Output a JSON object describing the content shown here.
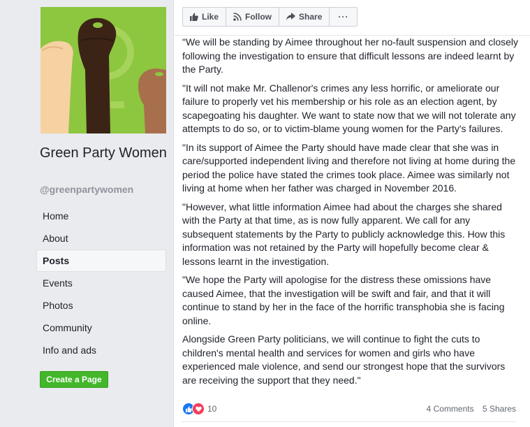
{
  "page": {
    "name": "Green Party Women",
    "handle": "@greenpartywomen"
  },
  "cover_image": {
    "description_icon": "raised-fists-image",
    "background_color": "#8dc63f"
  },
  "nav": {
    "items": [
      {
        "label": "Home",
        "active": false
      },
      {
        "label": "About",
        "active": false
      },
      {
        "label": "Posts",
        "active": true
      },
      {
        "label": "Events",
        "active": false
      },
      {
        "label": "Photos",
        "active": false
      },
      {
        "label": "Community",
        "active": false
      },
      {
        "label": "Info and ads",
        "active": false
      }
    ]
  },
  "create_page_label": "Create a Page",
  "actions": {
    "like": "Like",
    "follow": "Follow",
    "share": "Share",
    "more": "···"
  },
  "post": {
    "paragraphs": [
      "\"We will be standing by Aimee throughout her no-fault suspension and closely following the investigation to ensure that difficult lessons are indeed learnt by the Party.",
      "\"It will not make Mr. Challenor's crimes any less horrific, or ameliorate our failure to properly vet his membership or his role as an election agent, by scapegoating his daughter. We want to state now that we will not tolerate any attempts to do so, or to victim-blame young women for the Party's failures.",
      "\"In its support of Aimee the Party should have made clear that she was in care/supported independent living and therefore not living at home during the period the police have stated the crimes took place. Aimee was similarly not living at home when her father was charged in November 2016.",
      "\"However, what little information Aimee had about the charges she shared with the Party at that time, as is now fully apparent. We call for any subsequent statements by the Party to publicly acknowledge this. How this information was not retained by the Party will hopefully become clear & lessons learnt in the investigation.",
      "\"We hope the Party will apologise for the distress these omissions have caused Aimee, that the investigation will be swift and fair, and that it will continue to stand by her in the face of the horrific transphobia she is facing online.",
      "Alongside Green Party politicians, we will continue to fight the cuts to children's mental health and services for women and girls who have experienced male violence, and send our strongest hope that the survivors are receiving the support that they need.\""
    ],
    "reaction_count": "10",
    "comments": "4 Comments",
    "shares": "5 Shares"
  },
  "colors": {
    "page_bg": "#e9ebee",
    "create_button": "#42b72a",
    "like_reaction": "#1877f2",
    "love_reaction": "#f33e58"
  }
}
